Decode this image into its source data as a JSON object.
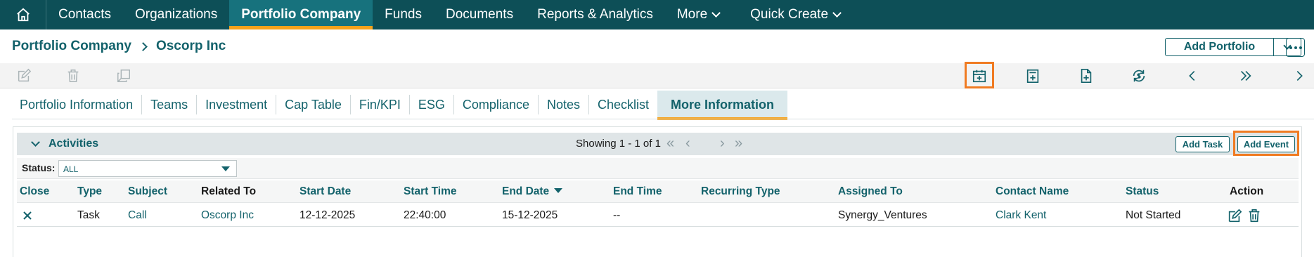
{
  "nav": {
    "home_icon": "home-icon",
    "items": [
      {
        "label": "Contacts"
      },
      {
        "label": "Organizations"
      },
      {
        "label": "Portfolio Company",
        "active": true
      },
      {
        "label": "Funds"
      },
      {
        "label": "Documents"
      },
      {
        "label": "Reports & Analytics"
      },
      {
        "label": "More",
        "dropdown": true
      },
      {
        "label": "Quick Create",
        "dropdown": true
      }
    ],
    "colors": {
      "bar": "#0d4f57",
      "active": "#17727d",
      "accent": "#f6a21b"
    }
  },
  "breadcrumb": {
    "parent": "Portfolio Company",
    "current": "Oscorp Inc"
  },
  "header_actions": {
    "add_portfolio_label": "Add Portfolio"
  },
  "toolbar": {
    "left_icons": [
      "edit-icon",
      "delete-icon",
      "duplicate-icon"
    ],
    "right_icons": [
      "add-event-calendar-icon",
      "add-task-icon",
      "add-document-icon",
      "sync-finance-icon",
      "previous-icon",
      "last-icon",
      "next-icon"
    ],
    "highlight_color": "#f07b22"
  },
  "tabs": [
    {
      "label": "Portfolio Information"
    },
    {
      "label": "Teams"
    },
    {
      "label": "Investment"
    },
    {
      "label": "Cap Table"
    },
    {
      "label": "Fin/KPI"
    },
    {
      "label": "ESG"
    },
    {
      "label": "Compliance"
    },
    {
      "label": "Notes"
    },
    {
      "label": "Checklist"
    },
    {
      "label": "More Information",
      "active": true
    }
  ],
  "activities": {
    "title": "Activities",
    "showing": "Showing 1 - 1 of 1",
    "add_task_label": "Add Task",
    "add_event_label": "Add Event",
    "filter_label": "Status:",
    "filter_value": "ALL",
    "columns": [
      "Close",
      "Type",
      "Subject",
      "Related To",
      "Start Date",
      "Start Time",
      "End Date",
      "End Time",
      "Recurring Type",
      "Assigned To",
      "Contact Name",
      "Status",
      "Action"
    ],
    "rows": [
      {
        "type": "Task",
        "subject": "Call",
        "related_to": "Oscorp Inc",
        "start_date": "12-12-2025",
        "start_time": "22:40:00",
        "end_date": "15-12-2025",
        "end_time": "--",
        "recurring_type": "",
        "assigned_to": "Synergy_Ventures",
        "contact_name": "Clark Kent",
        "status": "Not Started"
      }
    ]
  }
}
